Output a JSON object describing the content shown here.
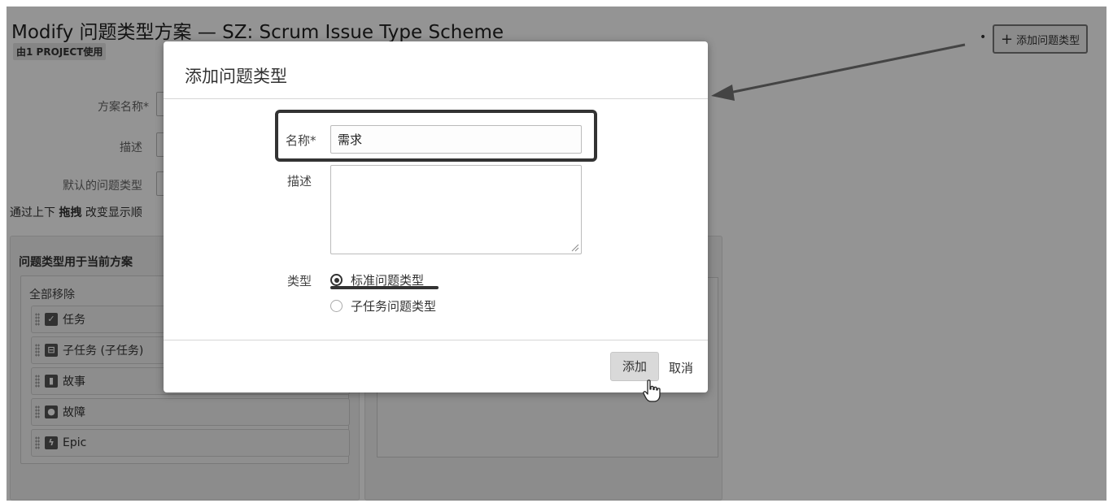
{
  "page": {
    "title": "Modify 问题类型方案 — SZ: Scrum Issue Type Scheme",
    "usage_badge": "由1 PROJECT使用",
    "form": {
      "scheme_name_label": "方案名称*",
      "description_label": "描述",
      "default_type_label": "默认的问题类型"
    },
    "drag_hint_prefix": "通过上下 ",
    "drag_hint_bold": "拖拽",
    "drag_hint_suffix": " 改变显示顺",
    "add_issue_type_button": "添加问题类型",
    "current_panel": {
      "title": "问题类型用于当前方案",
      "remove_all": "全部移除",
      "items": [
        {
          "label": "任务",
          "icon": "task-icon"
        },
        {
          "label": "子任务 (子任务)",
          "icon": "subtask-icon"
        },
        {
          "label": "故事",
          "icon": "story-icon"
        },
        {
          "label": "故障",
          "icon": "bug-icon"
        },
        {
          "label": "Epic",
          "icon": "epic-icon"
        }
      ]
    }
  },
  "dialog": {
    "title": "添加问题类型",
    "name_label": "名称*",
    "name_value": "需求",
    "description_label": "描述",
    "description_value": "",
    "type_label": "类型",
    "type_options": [
      {
        "label": "标准问题类型",
        "checked": true
      },
      {
        "label": "子任务问题类型",
        "checked": false
      }
    ],
    "add_button": "添加",
    "cancel_link": "取消"
  },
  "colors": {
    "overlay": "#000000",
    "highlight_border": "#333333"
  }
}
